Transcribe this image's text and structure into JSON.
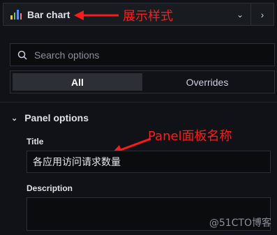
{
  "visualization": {
    "name": "Bar chart",
    "icon": "bar-chart-icon",
    "chevron_icon": "chevron-down-icon",
    "collapse_icon": "chevron-right-icon",
    "icon_colors": [
      "#F2CC0C",
      "#73BF69",
      "#5794F2",
      "#FF7383"
    ]
  },
  "annotations": {
    "viz_note": "展示样式",
    "title_note": "Panel面板名称",
    "color": "#ff1a1a"
  },
  "search": {
    "placeholder": "Search options",
    "value": ""
  },
  "tabs": [
    {
      "label": "All",
      "active": true
    },
    {
      "label": "Overrides",
      "active": false
    }
  ],
  "panel_options": {
    "section_title": "Panel options",
    "title_label": "Title",
    "title_value": "各应用访问请求数量",
    "description_label": "Description",
    "description_value": ""
  },
  "watermark": "@51CTO博客"
}
